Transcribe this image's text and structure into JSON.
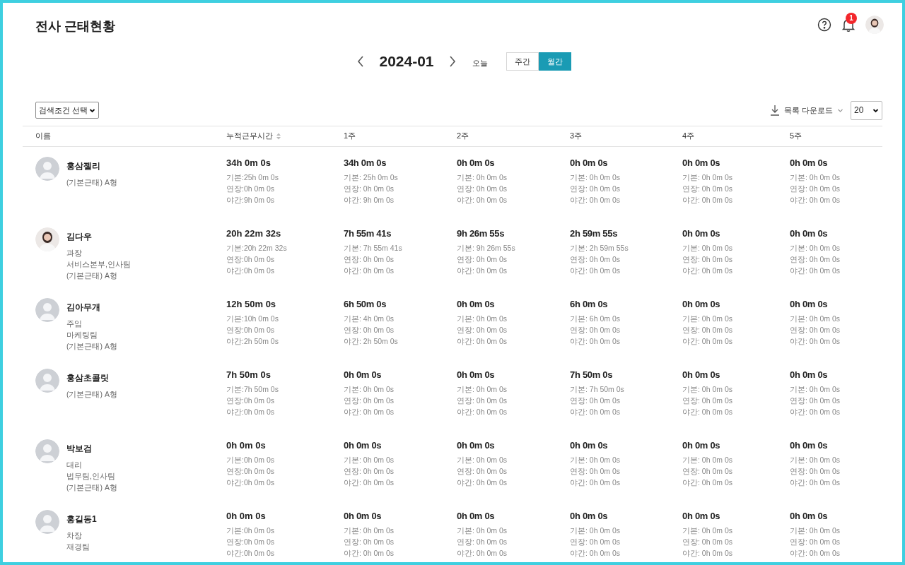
{
  "title": "전사 근태현황",
  "header_icons": {
    "notification_count": "1"
  },
  "period": {
    "label": "2024-01",
    "today": "오늘",
    "views": [
      {
        "label": "주간",
        "selected": false
      },
      {
        "label": "월간",
        "selected": true
      }
    ]
  },
  "filter": {
    "value": "검색조건 선택"
  },
  "download": {
    "label": "목록 다운로드"
  },
  "page_size": {
    "value": "20"
  },
  "table": {
    "columns": [
      {
        "label": "이름",
        "kind": "plain"
      },
      {
        "label": "누적근무시간",
        "kind": "sortable"
      },
      {
        "label": "1주",
        "kind": "plain"
      },
      {
        "label": "2주",
        "kind": "plain"
      },
      {
        "label": "3주",
        "kind": "plain"
      },
      {
        "label": "4주",
        "kind": "plain"
      },
      {
        "label": "5주",
        "kind": "plain"
      }
    ],
    "rows": [
      {
        "name": "홍삼젤리",
        "avatar": {
          "kind": "default"
        },
        "info": [
          "(기본근태) A형"
        ],
        "total": {
          "time": "34h 0m 0s",
          "details": [
            "기본:25h 0m 0s",
            "연장:0h 0m 0s",
            "야간:9h 0m 0s"
          ]
        },
        "weeks": [
          {
            "time": "34h 0m 0s",
            "details": [
              "기본: 25h 0m 0s",
              "연장: 0h 0m 0s",
              "야간: 9h 0m 0s"
            ]
          },
          {
            "time": "0h 0m 0s",
            "details": [
              "기본: 0h 0m 0s",
              "연장: 0h 0m 0s",
              "야간: 0h 0m 0s"
            ]
          },
          {
            "time": "0h 0m 0s",
            "details": [
              "기본: 0h 0m 0s",
              "연장: 0h 0m 0s",
              "야간: 0h 0m 0s"
            ]
          },
          {
            "time": "0h 0m 0s",
            "details": [
              "기본: 0h 0m 0s",
              "연장: 0h 0m 0s",
              "야간: 0h 0m 0s"
            ]
          },
          {
            "time": "0h 0m 0s",
            "details": [
              "기본: 0h 0m 0s",
              "연장: 0h 0m 0s",
              "야간: 0h 0m 0s"
            ]
          }
        ]
      },
      {
        "name": "김다우",
        "avatar": {
          "kind": "photo"
        },
        "info": [
          "과장",
          "서비스본부,인사팀",
          "(기본근태) A형"
        ],
        "total": {
          "time": "20h 22m 32s",
          "details": [
            "기본:20h 22m 32s",
            "연장:0h 0m 0s",
            "야간:0h 0m 0s"
          ]
        },
        "weeks": [
          {
            "time": "7h 55m 41s",
            "details": [
              "기본: 7h 55m 41s",
              "연장: 0h 0m 0s",
              "야간: 0h 0m 0s"
            ]
          },
          {
            "time": "9h 26m 55s",
            "details": [
              "기본: 9h 26m 55s",
              "연장: 0h 0m 0s",
              "야간: 0h 0m 0s"
            ]
          },
          {
            "time": "2h 59m 55s",
            "details": [
              "기본: 2h 59m 55s",
              "연장: 0h 0m 0s",
              "야간: 0h 0m 0s"
            ]
          },
          {
            "time": "0h 0m 0s",
            "details": [
              "기본: 0h 0m 0s",
              "연장: 0h 0m 0s",
              "야간: 0h 0m 0s"
            ]
          },
          {
            "time": "0h 0m 0s",
            "details": [
              "기본: 0h 0m 0s",
              "연장: 0h 0m 0s",
              "야간: 0h 0m 0s"
            ]
          }
        ]
      },
      {
        "name": "김아무개",
        "avatar": {
          "kind": "default"
        },
        "info": [
          "주임",
          "마케팅팀",
          "(기본근태) A형"
        ],
        "total": {
          "time": "12h 50m 0s",
          "details": [
            "기본:10h 0m 0s",
            "연장:0h 0m 0s",
            "야간:2h 50m 0s"
          ]
        },
        "weeks": [
          {
            "time": "6h 50m 0s",
            "details": [
              "기본: 4h 0m 0s",
              "연장: 0h 0m 0s",
              "야간: 2h 50m 0s"
            ]
          },
          {
            "time": "0h 0m 0s",
            "details": [
              "기본: 0h 0m 0s",
              "연장: 0h 0m 0s",
              "야간: 0h 0m 0s"
            ]
          },
          {
            "time": "6h 0m 0s",
            "details": [
              "기본: 6h 0m 0s",
              "연장: 0h 0m 0s",
              "야간: 0h 0m 0s"
            ]
          },
          {
            "time": "0h 0m 0s",
            "details": [
              "기본: 0h 0m 0s",
              "연장: 0h 0m 0s",
              "야간: 0h 0m 0s"
            ]
          },
          {
            "time": "0h 0m 0s",
            "details": [
              "기본: 0h 0m 0s",
              "연장: 0h 0m 0s",
              "야간: 0h 0m 0s"
            ]
          }
        ]
      },
      {
        "name": "홍삼초콜릿",
        "avatar": {
          "kind": "default"
        },
        "info": [
          "(기본근태) A형"
        ],
        "total": {
          "time": "7h 50m 0s",
          "details": [
            "기본:7h 50m 0s",
            "연장:0h 0m 0s",
            "야간:0h 0m 0s"
          ]
        },
        "weeks": [
          {
            "time": "0h 0m 0s",
            "details": [
              "기본: 0h 0m 0s",
              "연장: 0h 0m 0s",
              "야간: 0h 0m 0s"
            ]
          },
          {
            "time": "0h 0m 0s",
            "details": [
              "기본: 0h 0m 0s",
              "연장: 0h 0m 0s",
              "야간: 0h 0m 0s"
            ]
          },
          {
            "time": "7h 50m 0s",
            "details": [
              "기본: 7h 50m 0s",
              "연장: 0h 0m 0s",
              "야간: 0h 0m 0s"
            ]
          },
          {
            "time": "0h 0m 0s",
            "details": [
              "기본: 0h 0m 0s",
              "연장: 0h 0m 0s",
              "야간: 0h 0m 0s"
            ]
          },
          {
            "time": "0h 0m 0s",
            "details": [
              "기본: 0h 0m 0s",
              "연장: 0h 0m 0s",
              "야간: 0h 0m 0s"
            ]
          }
        ]
      },
      {
        "name": "박보검",
        "avatar": {
          "kind": "default"
        },
        "info": [
          "대리",
          "법무팀,인사팀",
          "(기본근태) A형"
        ],
        "total": {
          "time": "0h 0m 0s",
          "details": [
            "기본:0h 0m 0s",
            "연장:0h 0m 0s",
            "야간:0h 0m 0s"
          ]
        },
        "weeks": [
          {
            "time": "0h 0m 0s",
            "details": [
              "기본: 0h 0m 0s",
              "연장: 0h 0m 0s",
              "야간: 0h 0m 0s"
            ]
          },
          {
            "time": "0h 0m 0s",
            "details": [
              "기본: 0h 0m 0s",
              "연장: 0h 0m 0s",
              "야간: 0h 0m 0s"
            ]
          },
          {
            "time": "0h 0m 0s",
            "details": [
              "기본: 0h 0m 0s",
              "연장: 0h 0m 0s",
              "야간: 0h 0m 0s"
            ]
          },
          {
            "time": "0h 0m 0s",
            "details": [
              "기본: 0h 0m 0s",
              "연장: 0h 0m 0s",
              "야간: 0h 0m 0s"
            ]
          },
          {
            "time": "0h 0m 0s",
            "details": [
              "기본: 0h 0m 0s",
              "연장: 0h 0m 0s",
              "야간: 0h 0m 0s"
            ]
          }
        ]
      },
      {
        "name": "홍길동1",
        "avatar": {
          "kind": "default"
        },
        "info": [
          "차장",
          "재경팀"
        ],
        "total": {
          "time": "0h 0m 0s",
          "details": [
            "기본:0h 0m 0s",
            "연장:0h 0m 0s",
            "야간:0h 0m 0s"
          ]
        },
        "weeks": [
          {
            "time": "0h 0m 0s",
            "details": [
              "기본: 0h 0m 0s",
              "연장: 0h 0m 0s",
              "야간: 0h 0m 0s"
            ]
          },
          {
            "time": "0h 0m 0s",
            "details": [
              "기본: 0h 0m 0s",
              "연장: 0h 0m 0s",
              "야간: 0h 0m 0s"
            ]
          },
          {
            "time": "0h 0m 0s",
            "details": [
              "기본: 0h 0m 0s",
              "연장: 0h 0m 0s",
              "야간: 0h 0m 0s"
            ]
          },
          {
            "time": "0h 0m 0s",
            "details": [
              "기본: 0h 0m 0s",
              "연장: 0h 0m 0s",
              "야간: 0h 0m 0s"
            ]
          },
          {
            "time": "0h 0m 0s",
            "details": [
              "기본: 0h 0m 0s",
              "연장: 0h 0m 0s",
              "야간: 0h 0m 0s"
            ]
          }
        ]
      }
    ]
  }
}
